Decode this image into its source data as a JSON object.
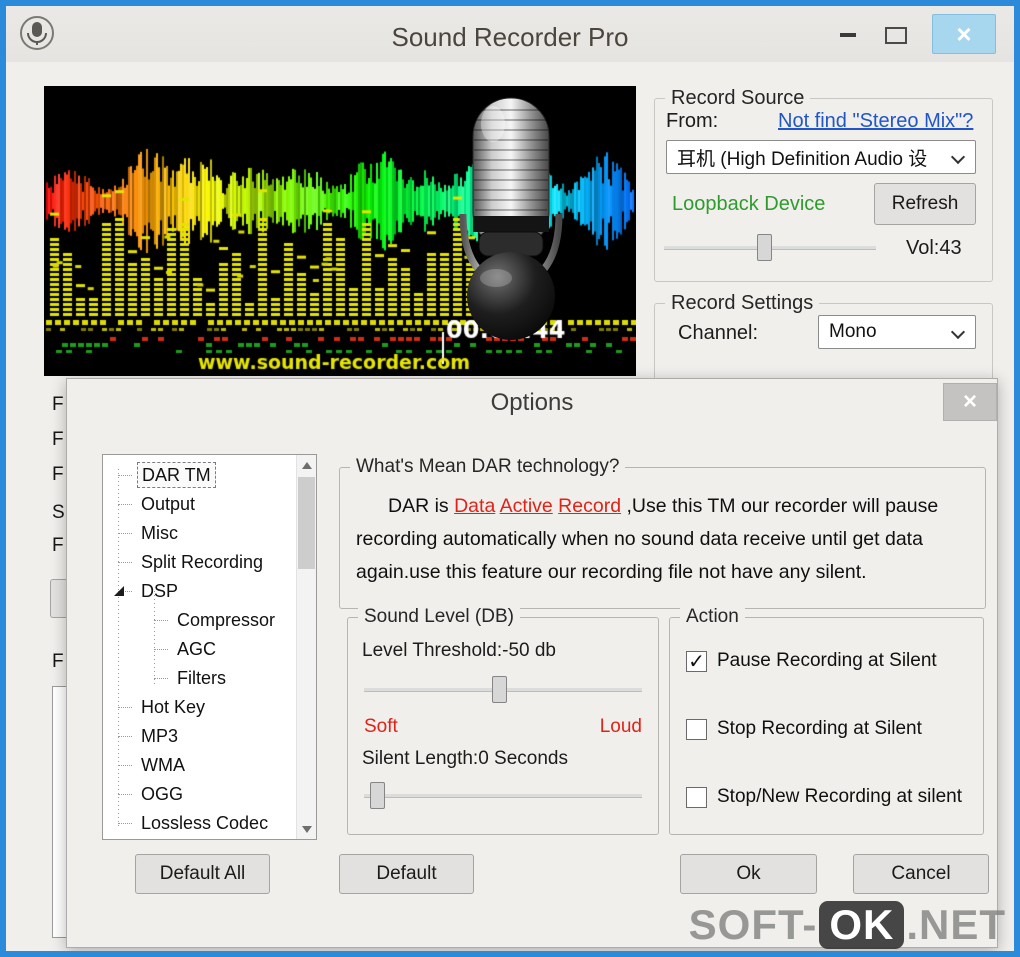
{
  "window": {
    "title": "Sound Recorder Pro",
    "controls": {
      "close": "×"
    }
  },
  "main": {
    "visual": {
      "timer": "00:00:44",
      "website": "www.sound-recorder.com"
    },
    "record_source": {
      "group_title": "Record Source",
      "from_label": "From:",
      "stereo_mix_link": "Not find \"Stereo Mix\"?",
      "device_value": "耳机 (High Definition Audio 设",
      "loopback_label": "Loopback Device",
      "refresh_button": "Refresh",
      "volume_label": "Vol:43"
    },
    "record_settings": {
      "group_title": "Record Settings",
      "channel_label": "Channel:",
      "channel_value": "Mono"
    },
    "clipped_labels": [
      "F",
      "F",
      "F",
      "S",
      "F",
      "F"
    ]
  },
  "dialog": {
    "title": "Options",
    "close": "×",
    "tree": {
      "items": [
        {
          "label": "DAR TM",
          "level": 0,
          "selected": true
        },
        {
          "label": "Output",
          "level": 0
        },
        {
          "label": "Misc",
          "level": 0
        },
        {
          "label": "Split Recording",
          "level": 0
        },
        {
          "label": "DSP",
          "level": 0,
          "expanded": true
        },
        {
          "label": "Compressor",
          "level": 1
        },
        {
          "label": "AGC",
          "level": 1
        },
        {
          "label": "Filters",
          "level": 1
        },
        {
          "label": "Hot Key",
          "level": 0
        },
        {
          "label": "MP3",
          "level": 0
        },
        {
          "label": "WMA",
          "level": 0
        },
        {
          "label": "OGG",
          "level": 0
        },
        {
          "label": "Lossless Codec",
          "level": 0
        }
      ]
    },
    "dar_group": {
      "title": "What's Mean DAR technology?",
      "prefix": "DAR is ",
      "words": [
        "Data",
        "Active",
        "Record"
      ],
      "suffix": " ,Use this TM our recorder will pause recording automatically when no sound data receive until get data again.use this feature our recording file not have any silent."
    },
    "sound_level_group": {
      "title": "Sound Level (DB)",
      "threshold_label": "Level Threshold:-50 db",
      "soft_label": "Soft",
      "loud_label": "Loud",
      "silent_label": "Silent Length:0 Seconds"
    },
    "action_group": {
      "title": "Action",
      "checkboxes": [
        {
          "label": "Pause Recording at Silent",
          "checked": true
        },
        {
          "label": "Stop Recording at Silent",
          "checked": false
        },
        {
          "label": "Stop/New Recording at silent",
          "checked": false
        }
      ]
    },
    "buttons": {
      "default_all": "Default All",
      "default": "Default",
      "ok": "Ok",
      "cancel": "Cancel"
    }
  },
  "watermark": {
    "prefix": "SOFT-",
    "ok": "OK",
    "suffix": ".NET"
  }
}
